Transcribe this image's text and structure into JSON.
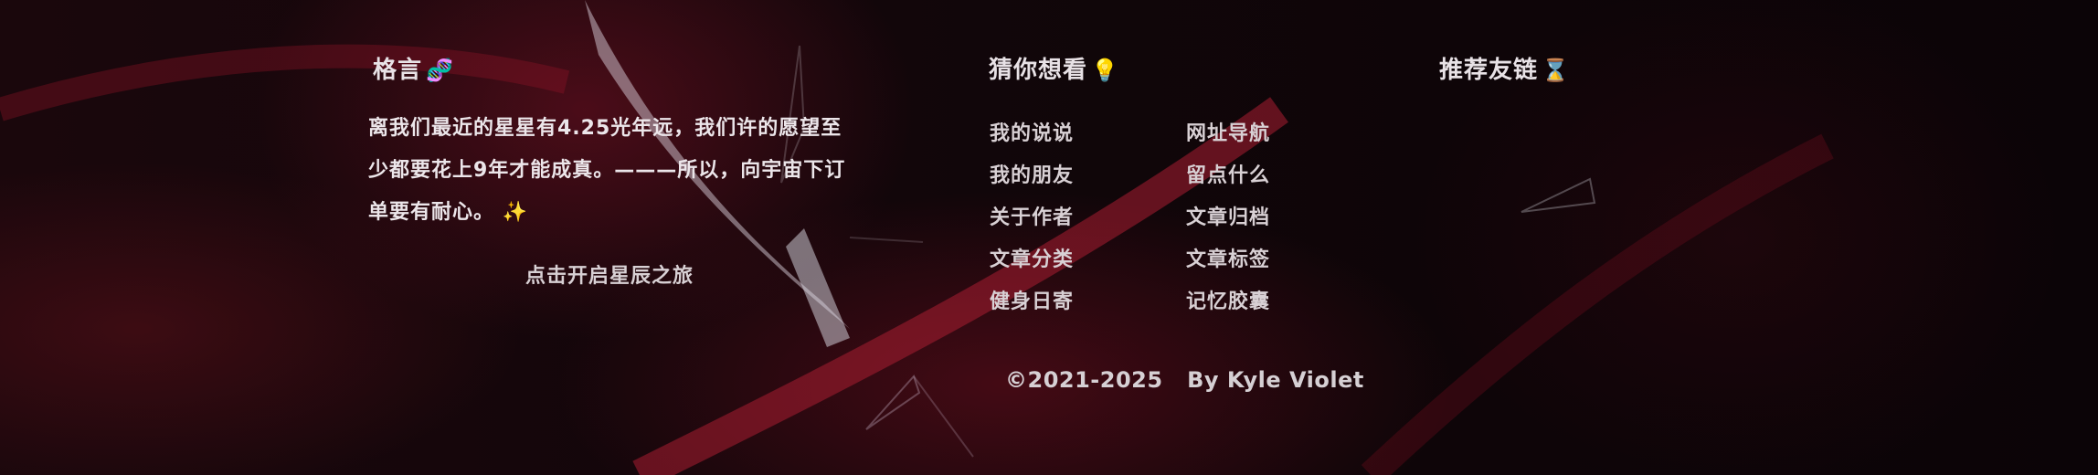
{
  "motto": {
    "title": "格言",
    "title_emoji": "🧬",
    "text": "离我们最近的星星有4.25光年远，我们许的愿望至少都要花上9年才能成真。———所以，向宇宙下订单要有耐心。",
    "sparkle": "✨",
    "cta_label": "点击开启星辰之旅"
  },
  "guess": {
    "title": "猜你想看",
    "title_emoji": "💡",
    "left_links": [
      "我的说说",
      "我的朋友",
      "关于作者",
      "文章分类",
      "健身日寄"
    ],
    "right_links": [
      "网址导航",
      "留点什么",
      "文章归档",
      "文章标签",
      "记忆胶囊"
    ]
  },
  "friends": {
    "title": "推荐友链",
    "title_emoji": "⌛"
  },
  "copyright": {
    "text": "©2021-2025   By Kyle Violet"
  },
  "colors": {
    "background": "#12060a",
    "text": "#ece6ea",
    "accent_red": "#8a1425"
  }
}
